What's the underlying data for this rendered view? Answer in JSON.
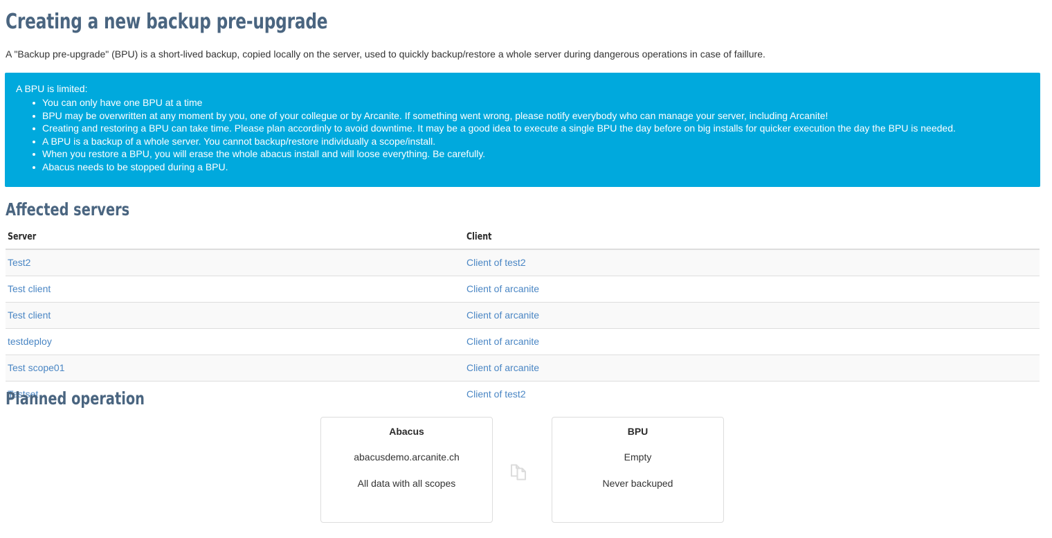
{
  "page": {
    "title": "Creating a new backup pre-upgrade",
    "intro": "A \"Backup pre-upgrade\" (BPU) is a short-lived backup, copied locally on the server, used to quickly backup/restore a whole server during dangerous operations in case of faillure."
  },
  "alert": {
    "accent_color": "#00a9dd",
    "text_color": "#ffffff",
    "lead": "A BPU is limited:",
    "items": [
      "You can only have one BPU at a time",
      "BPU may be overwritten at any moment by you, one of your collegue or by Arcanite. If something went wrong, please notify everybody who can manage your server, including Arcanite!",
      "Creating and restoring a BPU can take time. Please plan accordinly to avoid downtime. It may be a good idea to execute a single BPU the day before on big installs for quicker execution the day the BPU is needed.",
      "A BPU is a backup of a whole server. You cannot backup/restore individually a scope/install.",
      "When you restore a BPU, you will erase the whole abacus install and will loose everything. Be carefully.",
      "Abacus needs to be stopped during a BPU."
    ]
  },
  "affected_servers": {
    "heading": "Affected servers",
    "columns": [
      "Server",
      "Client"
    ],
    "rows": [
      {
        "server": "Test2",
        "client": "Client of test2"
      },
      {
        "server": "Test client",
        "client": "Client of arcanite"
      },
      {
        "server": "Test client",
        "client": "Client of arcanite"
      },
      {
        "server": "testdeploy",
        "client": "Client of arcanite"
      },
      {
        "server": "Test scope01",
        "client": "Client of arcanite"
      },
      {
        "server": "Testset",
        "client": "Client of test2"
      }
    ],
    "link_color": "#4a86c4"
  },
  "planned_operation": {
    "heading": "Planned operation",
    "icon": "copy-icon",
    "source": {
      "title": "Abacus",
      "line1": "abacusdemo.arcanite.ch",
      "line2": "All data with all scopes"
    },
    "target": {
      "title": "BPU",
      "line1": "Empty",
      "line2": "Never backuped"
    }
  },
  "theme": {
    "heading_color": "#4a6580",
    "body_color": "#333333",
    "border_color": "#dddddd",
    "stripe_color": "#f9f9f9"
  }
}
